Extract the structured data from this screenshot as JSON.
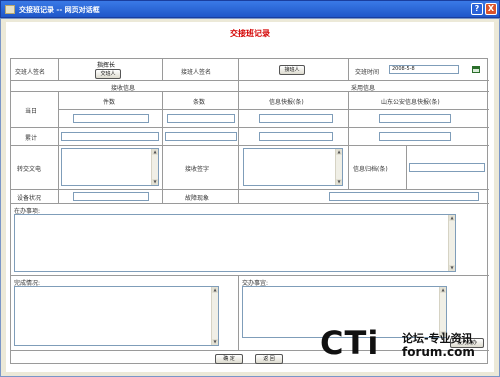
{
  "window": {
    "title": "交接班记录 -- 网页对话框",
    "help_label": "?",
    "close_label": "X"
  },
  "form": {
    "title": "交接班记录",
    "handover": {
      "giver_label": "交班人签名",
      "giver_role": "指挥长",
      "giver_button": "交班人",
      "receiver_label": "接班人签名",
      "receiver_button": "接班人",
      "time_label": "交班时间",
      "time_value": "2008-5-8"
    },
    "sections": {
      "receive": "接收信息",
      "adopt": "采用信息"
    },
    "columns": {
      "pieces": "件数",
      "items": "条数",
      "info_report": "信息快报(条)",
      "provincial_report": "山东公安信息快报(条)"
    },
    "rows": {
      "today": "当日",
      "total": "累计"
    },
    "dispatch_label": "转交文电",
    "receipt_label": "接收签字",
    "archive_label": "信息归档(条)",
    "equipment_label": "设备状况",
    "fault_label": "故障现象",
    "pending_label": "在办事项:",
    "completed_label": "完成情况:",
    "assigned_label": "交办事宜:",
    "set_assigned_button": "设为交办",
    "ok_button": "确 定",
    "back_button": "返 回"
  },
  "watermark": {
    "logo": "CTi",
    "tagline": "论坛-专业资讯",
    "site": "forum.com"
  }
}
